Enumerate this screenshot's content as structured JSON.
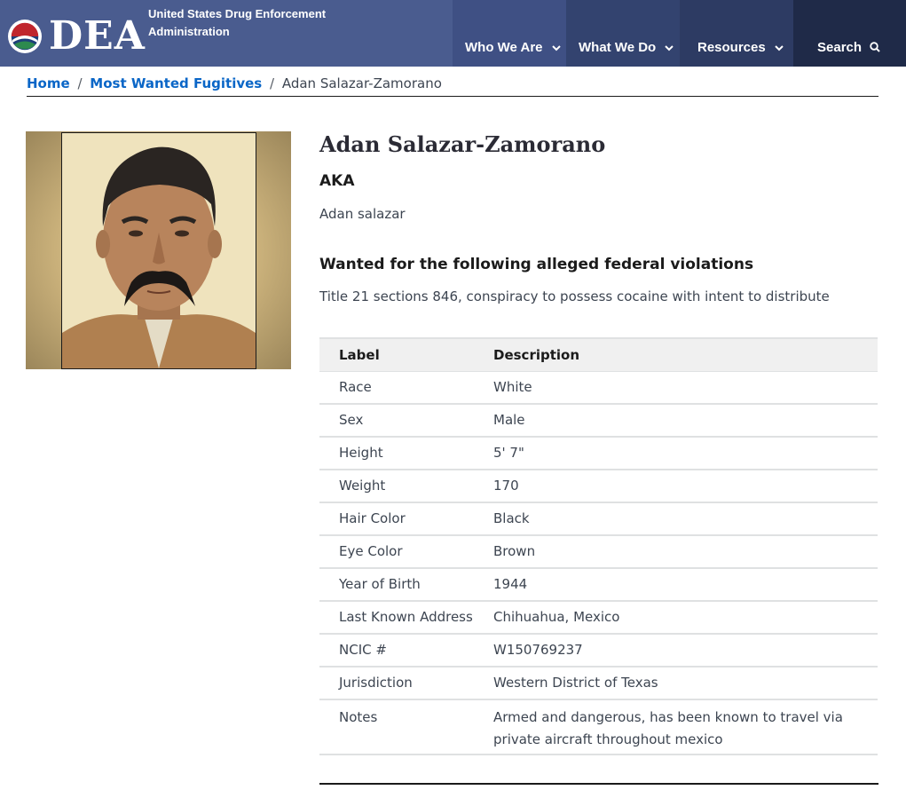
{
  "header": {
    "logo_text": "DEA",
    "agency_name": "United States Drug Enforcement Administration",
    "nav": {
      "who_we_are": "Who We Are",
      "what_we_do": "What We Do",
      "resources": "Resources",
      "search": "Search"
    },
    "colors": {
      "bar": "#4a5c8f",
      "search_bg": "#1f2a48"
    }
  },
  "breadcrumb": {
    "home": "Home",
    "separator": "/",
    "section": "Most Wanted Fugitives",
    "current": "Adan Salazar-Zamorano"
  },
  "fugitive": {
    "name": "Adan Salazar-Zamorano",
    "aka_heading": "AKA",
    "aka": "Adan salazar",
    "violations_heading": "Wanted for the following alleged federal violations",
    "violations": "Title 21 sections 846, conspiracy to possess cocaine with intent to distribute"
  },
  "details_table": {
    "headers": {
      "label": "Label",
      "description": "Description"
    },
    "rows": [
      {
        "label": "Race",
        "value": "White"
      },
      {
        "label": "Sex",
        "value": "Male"
      },
      {
        "label": "Height",
        "value": "5' 7\""
      },
      {
        "label": "Weight",
        "value": "170"
      },
      {
        "label": "Hair Color",
        "value": "Black"
      },
      {
        "label": "Eye Color",
        "value": "Brown"
      },
      {
        "label": "Year of Birth",
        "value": "1944"
      },
      {
        "label": "Last Known Address",
        "value": "Chihuahua, Mexico"
      },
      {
        "label": "NCIC #",
        "value": "W150769237"
      },
      {
        "label": "Jurisdiction",
        "value": "Western District of Texas"
      },
      {
        "label": "Notes",
        "value": "Armed and dangerous, has been known to travel via private aircraft throughout mexico"
      }
    ]
  },
  "icons": {
    "logo": "dea-seal-icon",
    "nav_dropdown": "chevron-down-icon",
    "search": "search-icon"
  }
}
